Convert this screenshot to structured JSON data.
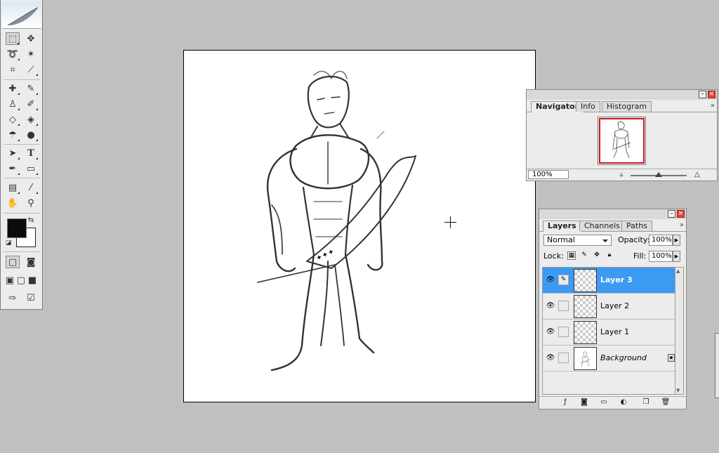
{
  "navigator": {
    "tabs": [
      "Navigator",
      "Info",
      "Histogram"
    ],
    "zoom": "100%",
    "menu_glyph": "»"
  },
  "layers_panel": {
    "tabs": [
      "Layers",
      "Channels",
      "Paths"
    ],
    "menu_glyph": "»",
    "blend_mode": "Normal",
    "opacity_label": "Opacity:",
    "opacity_value": "100%",
    "lock_label": "Lock:",
    "fill_label": "Fill:",
    "fill_value": "100%",
    "layers": [
      {
        "name": "Layer 3",
        "selected": true,
        "visible": true
      },
      {
        "name": "Layer 2",
        "selected": false,
        "visible": true
      },
      {
        "name": "Layer 1",
        "selected": false,
        "visible": true
      },
      {
        "name": "Background",
        "selected": false,
        "visible": true,
        "locked": true
      }
    ]
  },
  "toolbox": {
    "foreground_color": "#0c0c0c",
    "background_color": "#ffffff",
    "tools": [
      "marquee-icon",
      "move-icon",
      "lasso-icon",
      "magic-wand-icon",
      "crop-icon",
      "slice-icon",
      "healing-brush-icon",
      "brush-icon",
      "clone-stamp-icon",
      "history-brush-icon",
      "eraser-icon",
      "paint-bucket-icon",
      "blur-icon",
      "dodge-icon",
      "path-selection-icon",
      "type-icon",
      "pen-icon",
      "rectangle-icon",
      "notes-icon",
      "eyedropper-icon",
      "hand-icon",
      "zoom-icon"
    ]
  },
  "colors": {
    "workspace": "#c0c0c0",
    "selection": "#3c9af2",
    "close_button": "#e8463a"
  }
}
